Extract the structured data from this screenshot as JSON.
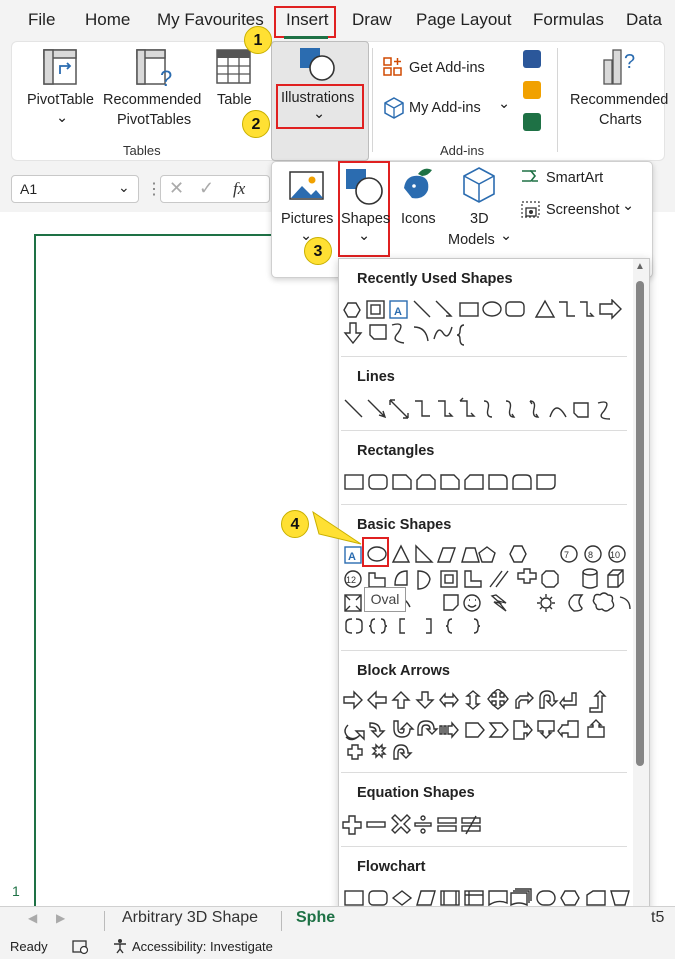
{
  "menu_tabs": [
    "File",
    "Home",
    "My Favourites",
    "Insert",
    "Draw",
    "Page Layout",
    "Formulas",
    "Data"
  ],
  "ribbon": {
    "pivottable": "PivotTable",
    "recommended_pivot_1": "Recommended",
    "recommended_pivot_2": "PivotTables",
    "table": "Table",
    "illustrations": "Illustrations",
    "get_addins": "Get Add-ins",
    "my_addins": "My Add-ins",
    "recommended_charts_1": "Recommended",
    "recommended_charts_2": "Charts",
    "group_tables": "Tables",
    "group_addins": "Add-ins"
  },
  "formula_bar": {
    "name_box": "A1",
    "fx": "fx"
  },
  "illustrations_menu": {
    "pictures": "Pictures",
    "shapes": "Shapes",
    "icons": "Icons",
    "models_1": "3D",
    "models_2": "Models",
    "smartart": "SmartArt",
    "screenshot": "Screenshot"
  },
  "callouts": [
    "1",
    "2",
    "3",
    "4"
  ],
  "shapes_menu": {
    "recent": "Recently Used Shapes",
    "lines": "Lines",
    "rectangles": "Rectangles",
    "basic": "Basic Shapes",
    "block_arrows": "Block Arrows",
    "equation": "Equation Shapes",
    "flowchart": "Flowchart"
  },
  "tooltip": "Oval",
  "row_number": "1",
  "sheet_tabs": {
    "arbitrary": "Arbitrary 3D Shape",
    "sphere": "Sphe",
    "last": "t5"
  },
  "status": {
    "ready": "Ready",
    "accessibility": "Accessibility: Investigate"
  },
  "colors": {
    "accent_green": "#1e7145",
    "highlight_red": "#e02020",
    "callout_yellow": "#ffe033",
    "office_blue": "#2b6cb0"
  }
}
